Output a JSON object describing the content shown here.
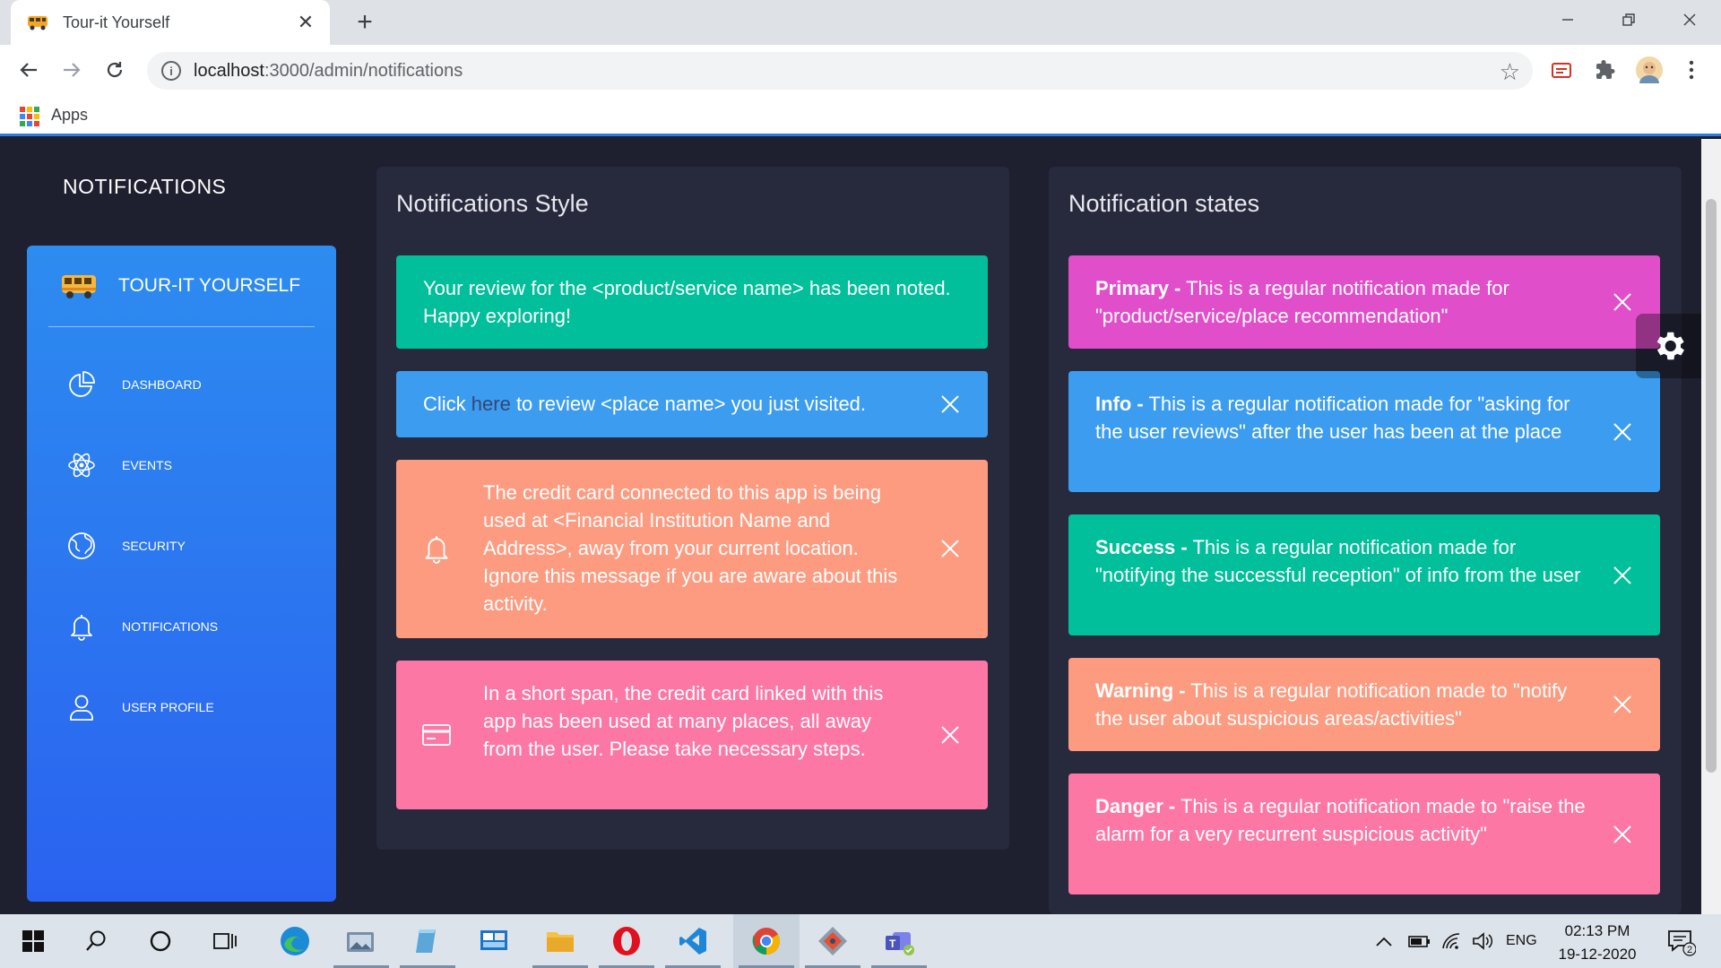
{
  "browser": {
    "tab_title": "Tour-it Yourself",
    "url_host": "localhost",
    "url_rest": ":3000/admin/notifications",
    "bookmarks": {
      "apps_label": "Apps"
    }
  },
  "page": {
    "title": "NOTIFICATIONS"
  },
  "sidebar": {
    "brand": "TOUR-IT YOURSELF",
    "items": [
      {
        "label": "DASHBOARD",
        "icon": "pie-chart-icon"
      },
      {
        "label": "EVENTS",
        "icon": "atom-icon"
      },
      {
        "label": "SECURITY",
        "icon": "globe-icon"
      },
      {
        "label": "NOTIFICATIONS",
        "icon": "bell-icon"
      },
      {
        "label": "USER PROFILE",
        "icon": "user-icon"
      }
    ]
  },
  "style_card": {
    "title": "Notifications Style",
    "alerts": [
      {
        "text": "Your review for the <product/service name> has been noted. Happy exploring!",
        "color": "#00bf9a"
      },
      {
        "prefix": "Click ",
        "link": "here",
        "suffix": " to review <place name> you just visited.",
        "color": "#3c9df0"
      },
      {
        "text": "The credit card connected to this app is being used at <Financial Institution Name and Address>, away from your current location. Ignore this message if you are aware about this activity.",
        "icon": "bell-icon",
        "color": "#fd9b80"
      },
      {
        "text": "In a short span, the credit card linked with this app has been used at many places, all away from the user. Please take necessary steps.",
        "icon": "credit-card-icon",
        "color": "#fd77a4"
      }
    ]
  },
  "states_card": {
    "title": "Notification states",
    "alerts": [
      {
        "label": "Primary -",
        "text": " This is a regular notification made for \"product/service/place recommendation\"",
        "color": "#e14eca"
      },
      {
        "label": "Info -",
        "text": " This is a regular notification made for \"asking for the user reviews\" after the user has been at the place",
        "color": "#3c9df0"
      },
      {
        "label": "Success -",
        "text": " This is a regular notification made for \"notifying the successful reception\" of info from the user",
        "color": "#00bf9a"
      },
      {
        "label": "Warning -",
        "text": " This is a regular notification made to \"notify the user about suspicious areas/activities\"",
        "color": "#fd9b80"
      },
      {
        "label": "Danger -",
        "text": " This is a regular notification made to \"raise the alarm for a very recurrent suspicious activity\"",
        "color": "#fd77a4"
      }
    ]
  },
  "taskbar": {
    "language": "ENG",
    "time": "02:13 PM",
    "date": "19-12-2020",
    "notification_count": "2"
  }
}
